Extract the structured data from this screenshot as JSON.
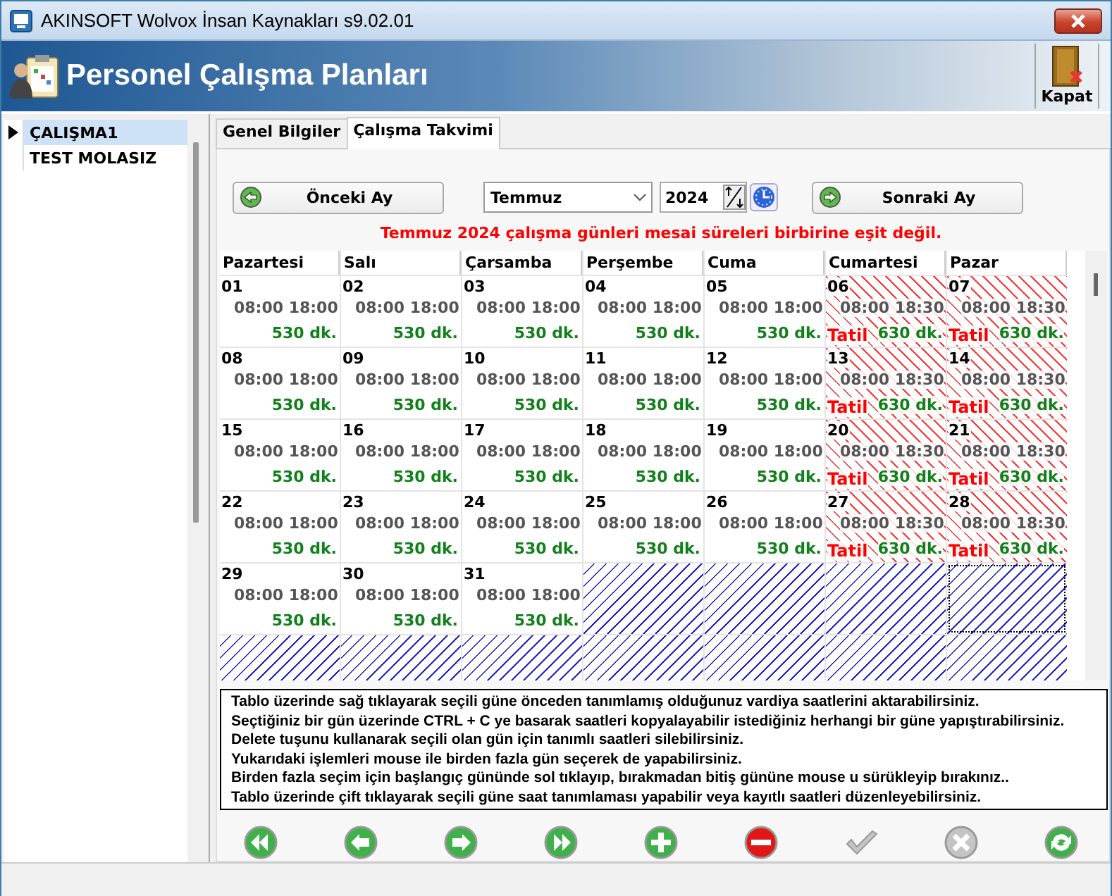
{
  "window": {
    "title": "AKINSOFT Wolvox İnsan Kaynakları s9.02.01"
  },
  "header": {
    "title": "Personel Çalışma Planları",
    "close_label": "Kapat"
  },
  "sidebar": {
    "items": [
      {
        "label": "ÇALIŞMA1",
        "selected": true
      },
      {
        "label": "TEST MOLASIZ",
        "selected": false
      }
    ]
  },
  "tabs": [
    {
      "label": "Genel Bilgiler",
      "selected": false
    },
    {
      "label": "Çalışma Takvimi",
      "selected": true
    }
  ],
  "controls": {
    "prev_label": "Önceki Ay",
    "month": "Temmuz",
    "year": "2024",
    "next_label": "Sonraki Ay"
  },
  "warning": "Temmuz 2024 çalışma günleri mesai süreleri birbirine eşit değil.",
  "calendar": {
    "columns": [
      "Pazartesi",
      "Salı",
      "Çarsamba",
      "Perşembe",
      "Cuma",
      "Cumartesi",
      "Pazar"
    ],
    "weeks": [
      [
        {
          "kind": "work",
          "day": "01",
          "hours": "08:00 18:00",
          "minutes": "530 dk.",
          "selected": false
        },
        {
          "kind": "work",
          "day": "02",
          "hours": "08:00 18:00",
          "minutes": "530 dk.",
          "selected": false
        },
        {
          "kind": "work",
          "day": "03",
          "hours": "08:00 18:00",
          "minutes": "530 dk.",
          "selected": false
        },
        {
          "kind": "work",
          "day": "04",
          "hours": "08:00 18:00",
          "minutes": "530 dk.",
          "selected": false
        },
        {
          "kind": "work",
          "day": "05",
          "hours": "08:00 18:00",
          "minutes": "530 dk.",
          "selected": false
        },
        {
          "kind": "holiday",
          "day": "06",
          "hours": "08:00 18:30",
          "label": "Tatil",
          "minutes": "630 dk.",
          "selected": false
        },
        {
          "kind": "holiday",
          "day": "07",
          "hours": "08:00 18:30",
          "label": "Tatil",
          "minutes": "630 dk.",
          "selected": false
        }
      ],
      [
        {
          "kind": "work",
          "day": "08",
          "hours": "08:00 18:00",
          "minutes": "530 dk.",
          "selected": false
        },
        {
          "kind": "work",
          "day": "09",
          "hours": "08:00 18:00",
          "minutes": "530 dk.",
          "selected": false
        },
        {
          "kind": "work",
          "day": "10",
          "hours": "08:00 18:00",
          "minutes": "530 dk.",
          "selected": false
        },
        {
          "kind": "work",
          "day": "11",
          "hours": "08:00 18:00",
          "minutes": "530 dk.",
          "selected": false
        },
        {
          "kind": "work",
          "day": "12",
          "hours": "08:00 18:00",
          "minutes": "530 dk.",
          "selected": false
        },
        {
          "kind": "holiday",
          "day": "13",
          "hours": "08:00 18:30",
          "label": "Tatil",
          "minutes": "630 dk.",
          "selected": false
        },
        {
          "kind": "holiday",
          "day": "14",
          "hours": "08:00 18:30",
          "label": "Tatil",
          "minutes": "630 dk.",
          "selected": false
        }
      ],
      [
        {
          "kind": "work",
          "day": "15",
          "hours": "08:00 18:00",
          "minutes": "530 dk.",
          "selected": false
        },
        {
          "kind": "work",
          "day": "16",
          "hours": "08:00 18:00",
          "minutes": "530 dk.",
          "selected": false
        },
        {
          "kind": "work",
          "day": "17",
          "hours": "08:00 18:00",
          "minutes": "530 dk.",
          "selected": false
        },
        {
          "kind": "work",
          "day": "18",
          "hours": "08:00 18:00",
          "minutes": "530 dk.",
          "selected": false
        },
        {
          "kind": "work",
          "day": "19",
          "hours": "08:00 18:00",
          "minutes": "530 dk.",
          "selected": false
        },
        {
          "kind": "holiday",
          "day": "20",
          "hours": "08:00 18:30",
          "label": "Tatil",
          "minutes": "630 dk.",
          "selected": false
        },
        {
          "kind": "holiday",
          "day": "21",
          "hours": "08:00 18:30",
          "label": "Tatil",
          "minutes": "630 dk.",
          "selected": false
        }
      ],
      [
        {
          "kind": "work",
          "day": "22",
          "hours": "08:00 18:00",
          "minutes": "530 dk.",
          "selected": false
        },
        {
          "kind": "work",
          "day": "23",
          "hours": "08:00 18:00",
          "minutes": "530 dk.",
          "selected": false
        },
        {
          "kind": "work",
          "day": "24",
          "hours": "08:00 18:00",
          "minutes": "530 dk.",
          "selected": false
        },
        {
          "kind": "work",
          "day": "25",
          "hours": "08:00 18:00",
          "minutes": "530 dk.",
          "selected": false
        },
        {
          "kind": "work",
          "day": "26",
          "hours": "08:00 18:00",
          "minutes": "530 dk.",
          "selected": false
        },
        {
          "kind": "holiday",
          "day": "27",
          "hours": "08:00 18:30",
          "label": "Tatil",
          "minutes": "630 dk.",
          "selected": false
        },
        {
          "kind": "holiday",
          "day": "28",
          "hours": "08:00 18:30",
          "label": "Tatil",
          "minutes": "630 dk.",
          "selected": false
        }
      ],
      [
        {
          "kind": "work",
          "day": "29",
          "hours": "08:00 18:00",
          "minutes": "530 dk.",
          "selected": false
        },
        {
          "kind": "work",
          "day": "30",
          "hours": "08:00 18:00",
          "minutes": "530 dk.",
          "selected": false
        },
        {
          "kind": "work",
          "day": "31",
          "hours": "08:00 18:00",
          "minutes": "530 dk.",
          "selected": false
        },
        {
          "kind": "empty",
          "selected": false
        },
        {
          "kind": "empty",
          "selected": false
        },
        {
          "kind": "empty",
          "selected": false
        },
        {
          "kind": "empty",
          "selected": true
        }
      ],
      [
        {
          "kind": "empty",
          "selected": false
        },
        {
          "kind": "empty",
          "selected": false
        },
        {
          "kind": "empty",
          "selected": false
        },
        {
          "kind": "empty",
          "selected": false
        },
        {
          "kind": "empty",
          "selected": false
        },
        {
          "kind": "empty",
          "selected": false
        },
        {
          "kind": "empty",
          "selected": false
        }
      ]
    ]
  },
  "hints": [
    "Tablo üzerinde sağ tıklayarak seçili güne önceden tanımlamış olduğunuz vardiya saatlerini aktarabilirsiniz.",
    "Seçtiğiniz bir gün üzerinde CTRL + C ye basarak saatleri kopyalayabilir istediğiniz herhangi bir güne yapıştırabilirsiniz.",
    "Delete tuşunu kullanarak seçili olan gün için tanımlı saatleri silebilirsiniz.",
    "Yukarıdaki işlemleri mouse ile birden fazla gün seçerek de yapabilirsiniz.",
    "Birden fazla seçim için başlangıç gününde sol tıklayıp, bırakmadan bitiş gününe mouse u sürükleyip bırakınız..",
    "Tablo üzerinde çift tıklayarak seçili güne saat tanımlaması yapabilir veya kayıtlı saatleri düzenleyebilirsiniz."
  ],
  "toolbar": [
    {
      "kind": "first",
      "disabled": false
    },
    {
      "kind": "prev",
      "disabled": false
    },
    {
      "kind": "next",
      "disabled": false
    },
    {
      "kind": "last",
      "disabled": false
    },
    {
      "kind": "add",
      "disabled": false
    },
    {
      "kind": "delete",
      "disabled": false
    },
    {
      "kind": "save",
      "disabled": true
    },
    {
      "kind": "cancel",
      "disabled": true
    },
    {
      "kind": "refresh",
      "disabled": false
    }
  ]
}
